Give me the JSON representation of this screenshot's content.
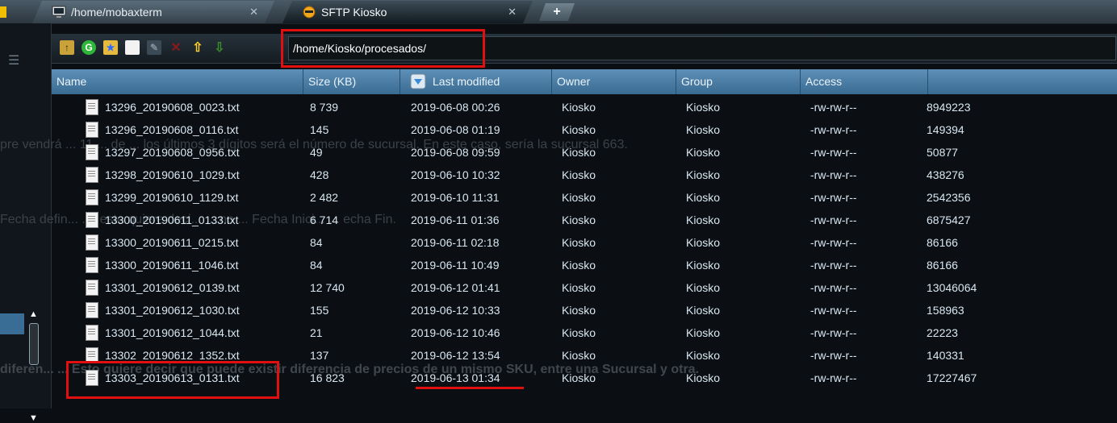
{
  "tabs": [
    {
      "label": "/home/mobaxterm",
      "icon": "terminal-icon",
      "close": "✕"
    },
    {
      "label": "SFTP Kiosko",
      "icon": "sftp-icon",
      "close": "✕"
    }
  ],
  "new_tab": "+",
  "toolbar": {
    "icons": [
      "parent-folder-icon",
      "refresh-icon",
      "new-folder-icon",
      "new-file-icon",
      "edit-icon",
      "delete-icon",
      "upload-icon",
      "download-icon"
    ],
    "path": "/home/Kiosko/procesados/"
  },
  "columns": [
    "Name",
    "Size (KB)",
    "Last modified",
    "Owner",
    "Group",
    "Access",
    ""
  ],
  "files": [
    {
      "name": "13296_20190608_0023.txt",
      "size": "8 739",
      "modified": "2019-06-08 00:26",
      "owner": "Kiosko",
      "group": "Kiosko",
      "access": "-rw-rw-r--",
      "bytes": "8949223"
    },
    {
      "name": "13296_20190608_0116.txt",
      "size": "145",
      "modified": "2019-06-08 01:19",
      "owner": "Kiosko",
      "group": "Kiosko",
      "access": "-rw-rw-r--",
      "bytes": "149394"
    },
    {
      "name": "13297_20190608_0956.txt",
      "size": "49",
      "modified": "2019-06-08 09:59",
      "owner": "Kiosko",
      "group": "Kiosko",
      "access": "-rw-rw-r--",
      "bytes": "50877"
    },
    {
      "name": "13298_20190610_1029.txt",
      "size": "428",
      "modified": "2019-06-10 10:32",
      "owner": "Kiosko",
      "group": "Kiosko",
      "access": "-rw-rw-r--",
      "bytes": "438276"
    },
    {
      "name": "13299_20190610_1129.txt",
      "size": "2 482",
      "modified": "2019-06-10 11:31",
      "owner": "Kiosko",
      "group": "Kiosko",
      "access": "-rw-rw-r--",
      "bytes": "2542356"
    },
    {
      "name": "13300_20190611_0133.txt",
      "size": "6 714",
      "modified": "2019-06-11 01:36",
      "owner": "Kiosko",
      "group": "Kiosko",
      "access": "-rw-rw-r--",
      "bytes": "6875427"
    },
    {
      "name": "13300_20190611_0215.txt",
      "size": "84",
      "modified": "2019-06-11 02:18",
      "owner": "Kiosko",
      "group": "Kiosko",
      "access": "-rw-rw-r--",
      "bytes": "86166"
    },
    {
      "name": "13300_20190611_1046.txt",
      "size": "84",
      "modified": "2019-06-11 10:49",
      "owner": "Kiosko",
      "group": "Kiosko",
      "access": "-rw-rw-r--",
      "bytes": "86166"
    },
    {
      "name": "13301_20190612_0139.txt",
      "size": "12 740",
      "modified": "2019-06-12 01:41",
      "owner": "Kiosko",
      "group": "Kiosko",
      "access": "-rw-rw-r--",
      "bytes": "13046064"
    },
    {
      "name": "13301_20190612_1030.txt",
      "size": "155",
      "modified": "2019-06-12 10:33",
      "owner": "Kiosko",
      "group": "Kiosko",
      "access": "-rw-rw-r--",
      "bytes": "158963"
    },
    {
      "name": "13301_20190612_1044.txt",
      "size": "21",
      "modified": "2019-06-12 10:46",
      "owner": "Kiosko",
      "group": "Kiosko",
      "access": "-rw-rw-r--",
      "bytes": "22223"
    },
    {
      "name": "13302_20190612_1352.txt",
      "size": "137",
      "modified": "2019-06-12 13:54",
      "owner": "Kiosko",
      "group": "Kiosko",
      "access": "-rw-rw-r--",
      "bytes": "140331"
    },
    {
      "name": "13303_20190613_0131.txt",
      "size": "16 823",
      "modified": "2019-06-13 01:34",
      "owner": "Kiosko",
      "group": "Kiosko",
      "access": "-rw-rw-r--",
      "bytes": "17227467"
    }
  ],
  "background_text": [
    "pre vendrá ... 11 ... de ... los últimos 3 dígitos será el número de sucursal. En este caso, sería la sucursal 663.",
    "Fecha defin... ..., esto quiere deci... ... no ... Fecha Inici... ... echa Fin.",
    "diferen... ... Esto quiere decir que puede existir diferencia de precios de un mismo SKU, entre una Sucursal y otra."
  ],
  "colors": {
    "accent": "#3a6b92",
    "highlight": "#e01010",
    "text": "#d8e7f2"
  }
}
